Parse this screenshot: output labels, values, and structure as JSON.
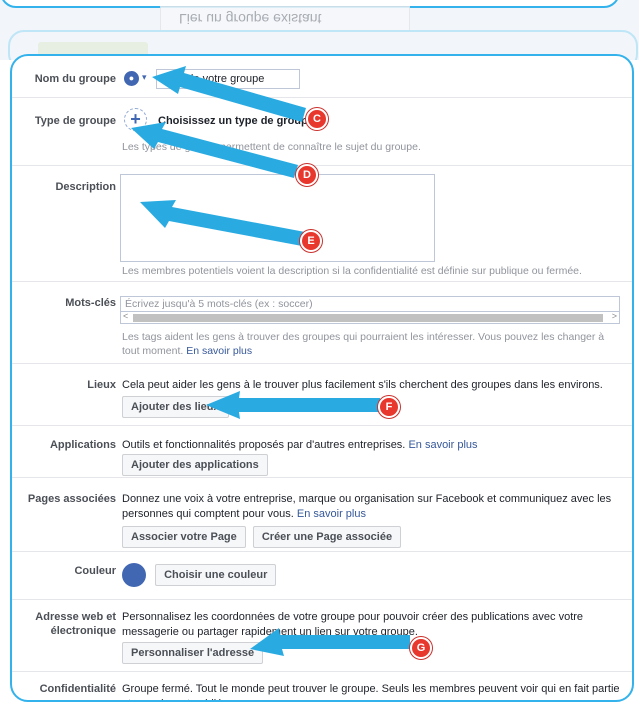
{
  "previous_screen": {
    "mirrored_text": "Lier un groupe existant"
  },
  "form": {
    "group_name": {
      "label": "Nom du groupe",
      "value": "Nom de votre groupe",
      "icon": "group-icon",
      "caret": "▾"
    },
    "group_type": {
      "label": "Type de groupe",
      "plus": "+",
      "title": "Choisissez un type de groupe",
      "help": "Les types de groupe permettent de connaître le sujet du groupe."
    },
    "description": {
      "label": "Description",
      "help": "Les membres potentiels voient la description si la confidentialité est définie sur publique ou fermée."
    },
    "keywords": {
      "label": "Mots-clés",
      "placeholder": "Écrivez jusqu'à 5 mots-clés (ex : soccer)",
      "help": "Les tags aident les gens à trouver des groupes qui pourraient les intéresser. Vous pouvez les changer à tout moment.",
      "link": "En savoir plus"
    },
    "places": {
      "label": "Lieux",
      "text": "Cela peut aider les gens à le trouver plus facilement s'ils cherchent des groupes dans les environs.",
      "button": "Ajouter des lieux"
    },
    "apps": {
      "label": "Applications",
      "text": "Outils et fonctionnalités proposés par d'autres entreprises.",
      "link": "En savoir plus",
      "button": "Ajouter des applications"
    },
    "linked_pages": {
      "label": "Pages associées",
      "text": "Donnez une voix à votre entreprise, marque ou organisation sur Facebook et communiquez avec les personnes qui comptent pour vous.",
      "link": "En savoir plus",
      "button_associate": "Associer votre Page",
      "button_create": "Créer une Page associée"
    },
    "color": {
      "label": "Couleur",
      "button": "Choisir une couleur",
      "value": "#4267b2"
    },
    "web_address": {
      "label_line1": "Adresse web et",
      "label_line2": "électronique",
      "text": "Personnalisez les coordonnées de votre groupe pour pouvoir créer des publications avec votre messagerie ou partager rapidement un lien sur votre groupe.",
      "button": "Personnaliser l'adresse"
    },
    "privacy": {
      "label": "Confidentialité",
      "text": "Groupe fermé. Tout le monde peut trouver le groupe. Seuls les membres peuvent voir qui en fait partie et ce qui y est publié."
    }
  },
  "annotations": {
    "C": "C",
    "D": "D",
    "E": "E",
    "F": "F",
    "G": "G"
  },
  "colors": {
    "accent": "#33b2ec",
    "badge": "#e8372d",
    "arrow": "#29abe2",
    "link": "#365899"
  }
}
